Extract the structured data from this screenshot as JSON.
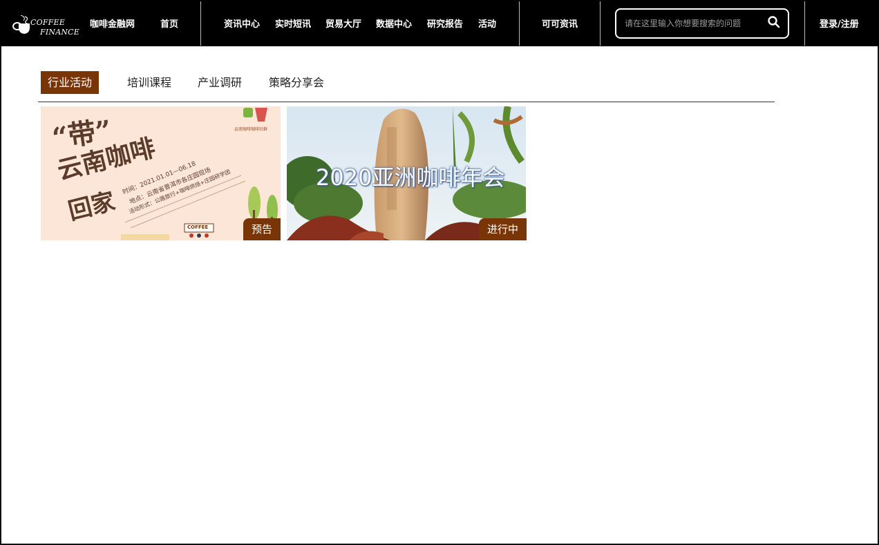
{
  "header": {
    "logo_line1": "COFFEE",
    "logo_line2": "FINANCE",
    "site_name": "咖啡金融网",
    "nav": [
      {
        "label": "首页"
      },
      {
        "label": "资讯中心"
      },
      {
        "label": "实时短讯"
      },
      {
        "label": "贸易大厅"
      },
      {
        "label": "数据中心"
      },
      {
        "label": "研究报告"
      },
      {
        "label": "活动"
      },
      {
        "label": "可可资讯"
      }
    ],
    "search_placeholder": "请在这里输入你想要搜索的问题",
    "login_label": "登录/注册"
  },
  "tabs": [
    {
      "label": "行业活动",
      "active": true
    },
    {
      "label": "培训课程",
      "active": false
    },
    {
      "label": "产业调研",
      "active": false
    },
    {
      "label": "策略分享会",
      "active": false
    }
  ],
  "cards": [
    {
      "status": "预告",
      "poster_title_1": "“带”",
      "poster_title_2": "云南咖啡",
      "poster_title_3": "回家",
      "poster_line_1": "时间：2021.01.01—06.18",
      "poster_line_2": "地点：云南省普洱市各庄园现场",
      "poster_line_3": "活动形式：公路旅行+咖啡烘焙+庄园研学团",
      "poster_logo_text": "云南咖啡咖啡社群",
      "poster_cup_text": "COFFEE"
    },
    {
      "status": "进行中",
      "overlay_title": "2020亚洲咖啡年会"
    }
  ],
  "colors": {
    "brand_brown": "#7a3507",
    "topbar_bg": "#000000"
  }
}
